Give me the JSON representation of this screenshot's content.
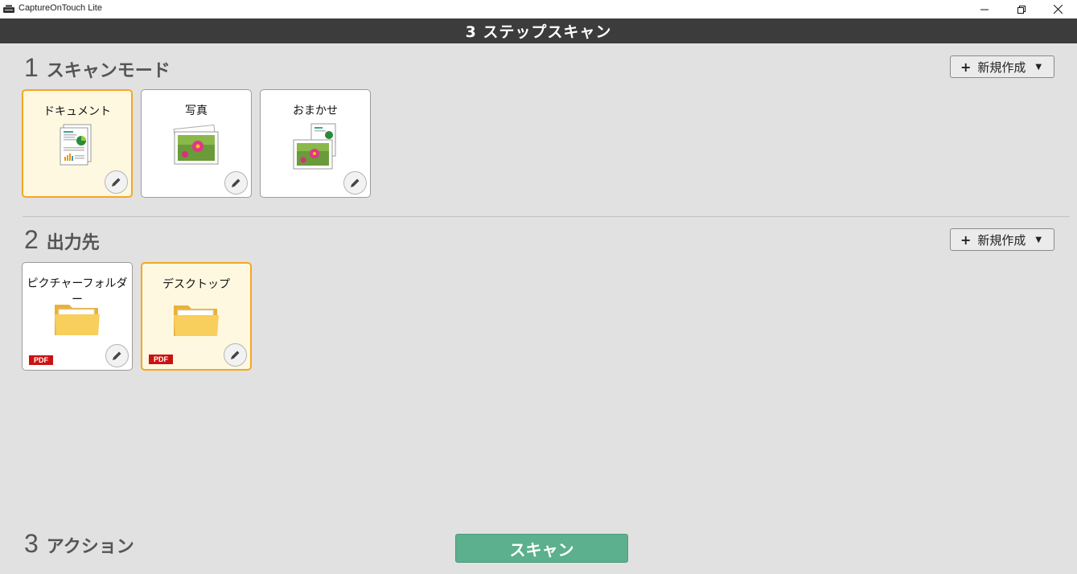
{
  "window": {
    "app_title": "CaptureOnTouch Lite"
  },
  "header": {
    "title": "3 ステップスキャン"
  },
  "section1": {
    "number": "1",
    "label": "スキャンモード",
    "new_button_label": "新規作成",
    "cards": [
      {
        "label": "ドキュメント",
        "icon": "document-icon",
        "selected": true
      },
      {
        "label": "写真",
        "icon": "photo-icon",
        "selected": false
      },
      {
        "label": "おまかせ",
        "icon": "auto-icon",
        "selected": false
      }
    ]
  },
  "section2": {
    "number": "2",
    "label": "出力先",
    "new_button_label": "新規作成",
    "cards": [
      {
        "label": "ピクチャーフォルダー",
        "icon": "folder-icon",
        "badge": "PDF",
        "selected": false
      },
      {
        "label": "デスクトップ",
        "icon": "folder-icon",
        "badge": "PDF",
        "selected": true
      }
    ]
  },
  "section3": {
    "number": "3",
    "label": "アクション",
    "scan_button_label": "スキャン"
  },
  "colors": {
    "header_bg": "#3c3c3c",
    "selected_border": "#f5a623",
    "selected_bg": "#fff8e1",
    "scan_button": "#5cb08e",
    "pdf_badge": "#cc1111"
  }
}
